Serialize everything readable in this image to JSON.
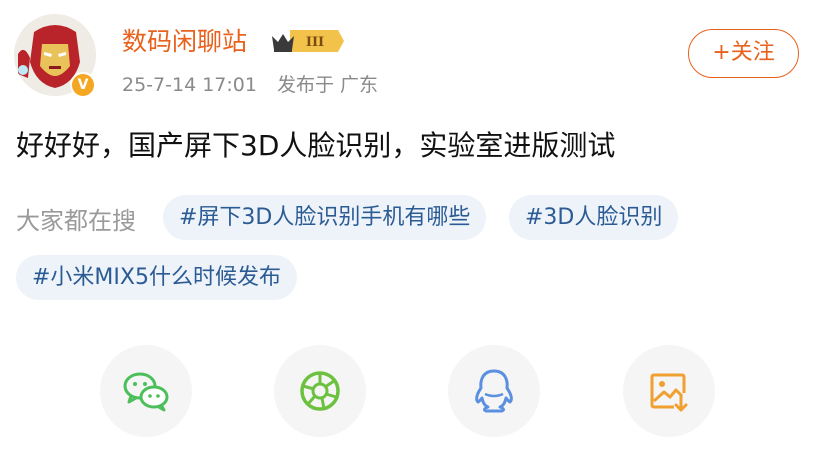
{
  "post": {
    "author": "数码闲聊站",
    "verified_badge": "V",
    "rank_badge": "III",
    "timestamp": "25-7-14 17:01",
    "location": "发布于 广东",
    "follow_label": "+关注",
    "text": "好好好，国产屏下3D人脸识别，实验室进版测试"
  },
  "search": {
    "label": "大家都在搜",
    "tags": [
      "#屏下3D人脸识别手机有哪些",
      "#3D人脸识别",
      "#小米MIX5什么时候发布"
    ]
  },
  "share_icons": [
    "wechat-icon",
    "moments-icon",
    "qq-icon",
    "save-image-icon"
  ],
  "colors": {
    "accent": "#e8621d",
    "tag_bg": "#eef3f9",
    "tag_text": "#2b5b94",
    "wechat_green": "#4cbf5a",
    "moments_green": "#6cc13f",
    "qq_blue": "#5b8fe0",
    "save_orange": "#f0a030"
  }
}
